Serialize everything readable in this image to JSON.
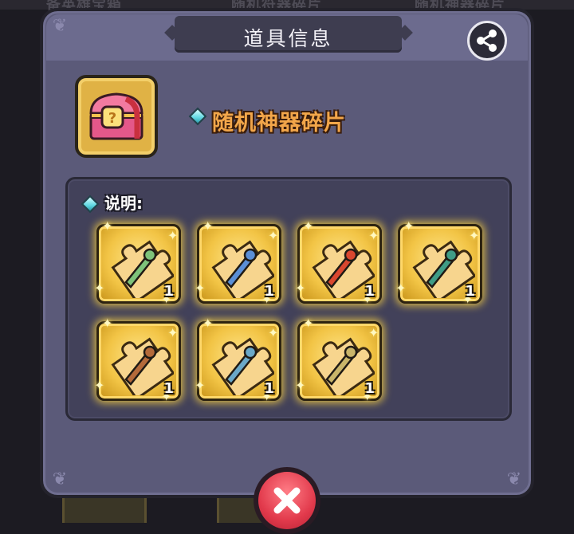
{
  "background": {
    "texts": [
      "备英雄宝箱",
      "随机符器碎片",
      "随机神器碎片"
    ]
  },
  "dialog": {
    "title": "道具信息",
    "share_icon": "share-icon",
    "close_icon": "close-icon"
  },
  "item": {
    "name": "随机神器碎片",
    "icon": "treasure-chest-icon"
  },
  "description": {
    "label": "说明:"
  },
  "rewards": [
    {
      "icon": "artifact-fragment-staff-icon",
      "count": "1",
      "accent": "#7ec27a"
    },
    {
      "icon": "artifact-fragment-blue-sword-icon",
      "count": "1",
      "accent": "#5b8fd6"
    },
    {
      "icon": "artifact-fragment-red-orb-icon",
      "count": "1",
      "accent": "#d9472f"
    },
    {
      "icon": "artifact-fragment-green-amulet-icon",
      "count": "1",
      "accent": "#3f9c86"
    },
    {
      "icon": "artifact-fragment-dagger-icon",
      "count": "1",
      "accent": "#b46a3a"
    },
    {
      "icon": "artifact-fragment-frost-blade-icon",
      "count": "1",
      "accent": "#6aa8c8"
    },
    {
      "icon": "artifact-fragment-bone-club-icon",
      "count": "1",
      "accent": "#c9b56a"
    }
  ],
  "colors": {
    "panel": "#5b5a79",
    "title_bar": "#3e3d50",
    "item_name": "#f2a64a",
    "tile_gold": "#f2c445",
    "close_red": "#e23a4c"
  }
}
